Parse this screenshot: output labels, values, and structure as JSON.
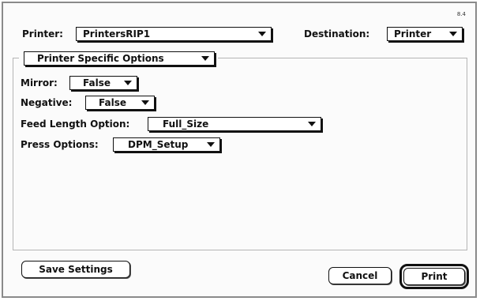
{
  "version": "8.4",
  "printer": {
    "label": "Printer:",
    "value": "PrintersRIP1"
  },
  "destination": {
    "label": "Destination:",
    "value": "Printer"
  },
  "options_menu": {
    "value": "Printer Specific Options"
  },
  "fields": {
    "mirror": {
      "label": "Mirror:",
      "value": "False"
    },
    "negative": {
      "label": "Negative:",
      "value": "False"
    },
    "feed_length": {
      "label": "Feed Length Option:",
      "value": "Full_Size"
    },
    "press": {
      "label": "Press Options:",
      "value": "DPM_Setup"
    }
  },
  "buttons": {
    "save": "Save Settings",
    "cancel": "Cancel",
    "print": "Print"
  }
}
